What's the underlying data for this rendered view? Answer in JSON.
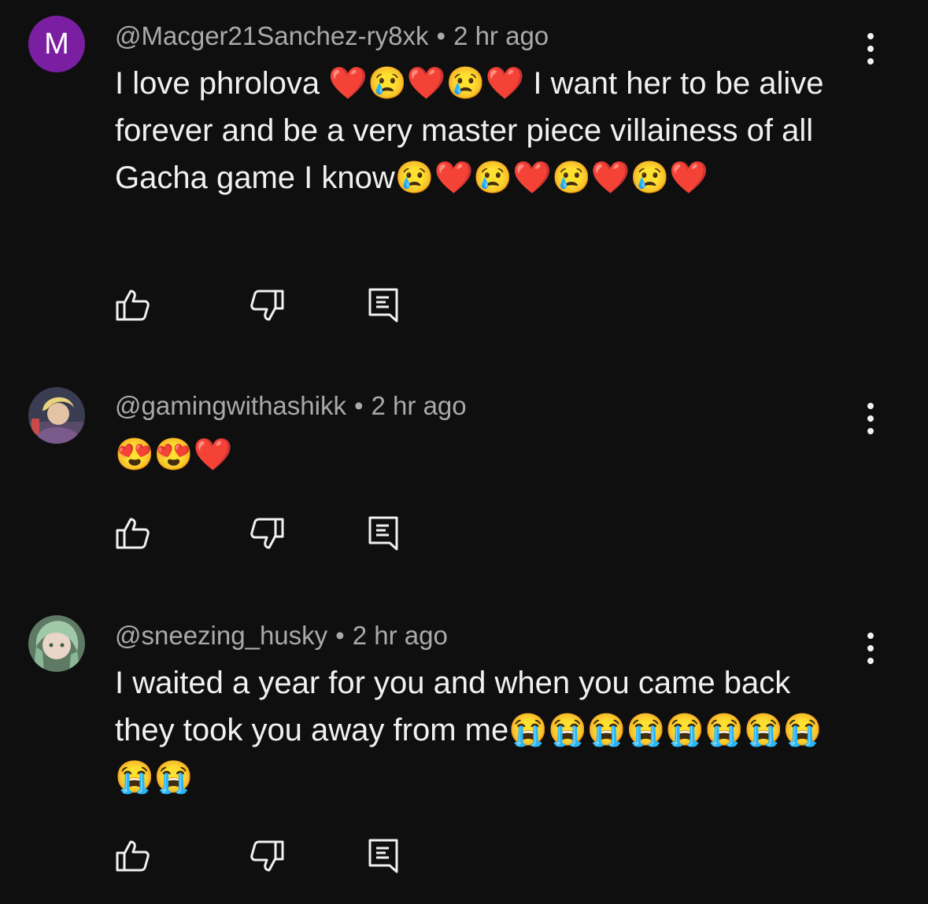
{
  "comments": [
    {
      "handle": "@Macger21Sanchez-ry8xk",
      "separator": "•",
      "time": "2 hr ago",
      "avatar_letter": "M",
      "avatar_color": "#7b1fa2",
      "text": "I love phrolova ❤️😢❤️😢❤️ I want her to be alive forever and be a very master piece villainess of all Gacha game I know😢❤️😢❤️😢❤️😢❤️"
    },
    {
      "handle": "@gamingwithashikk",
      "separator": "•",
      "time": "2 hr ago",
      "avatar_letter": "",
      "text": "😍😍❤️"
    },
    {
      "handle": "@sneezing_husky",
      "separator": "•",
      "time": "2 hr ago",
      "avatar_letter": "",
      "text": "I waited a year for you and when you came back they took you away from me😭😭😭😭😭😭😭😭😭😭"
    }
  ],
  "icons": {
    "like": "thumbs-up-icon",
    "dislike": "thumbs-down-icon",
    "reply": "reply-comment-icon",
    "more": "more-vertical-icon"
  },
  "colors": {
    "background": "#0f0f0f",
    "text": "#f1f1f1",
    "meta": "#aaaaaa"
  }
}
